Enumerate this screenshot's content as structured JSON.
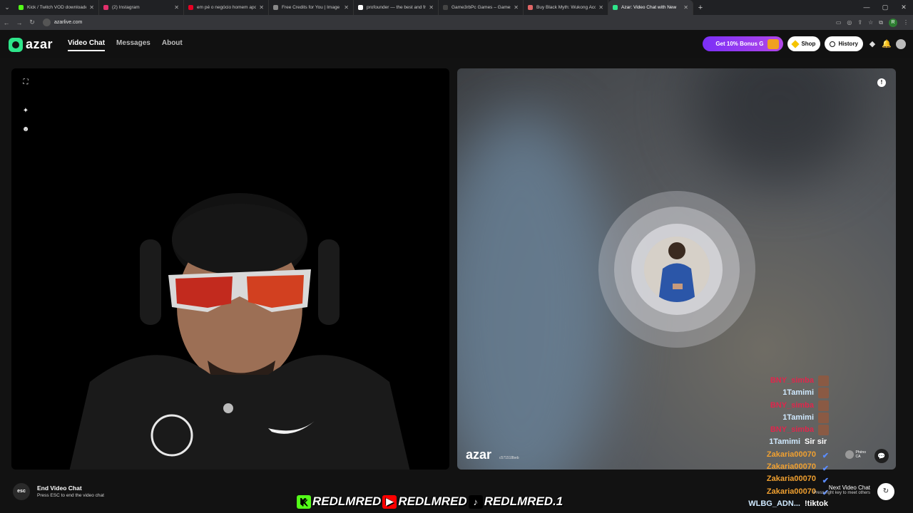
{
  "browser": {
    "tabs": [
      {
        "title": "Kick / Twitch VOD downloader",
        "color": "#53fc18"
      },
      {
        "title": "(2) Instagram",
        "color": "#e1306c"
      },
      {
        "title": "em pé o negócio homem apon",
        "color": "#e60023"
      },
      {
        "title": "Free Credits for You | Image",
        "color": "#888888"
      },
      {
        "title": "profounder — the best and fre",
        "color": "#ffffff"
      },
      {
        "title": "Game3rbPc Games – Games Or",
        "color": "#444444"
      },
      {
        "title": "Buy Black Myth: Wukong Acco",
        "color": "#e06666"
      },
      {
        "title": "Azar: Video Chat with New",
        "color": "#2ee58a",
        "active": true
      }
    ],
    "url": "azarlive.com"
  },
  "header": {
    "logo": "azar",
    "nav": [
      "Video Chat",
      "Messages",
      "About"
    ],
    "bonus": "Get 10% Bonus G",
    "shop": "Shop",
    "history": "History"
  },
  "remote": {
    "watermark": "azar",
    "watermark_id": "c571518beb"
  },
  "chat": [
    {
      "user": "BNY_simba",
      "color": "#e0264c",
      "msg": "",
      "thumb": true
    },
    {
      "user": "1Tamimi",
      "color": "#cfe9ff",
      "msg": "",
      "thumb": true
    },
    {
      "user": "BNY_simba",
      "color": "#e0264c",
      "msg": "",
      "thumb": true
    },
    {
      "user": "1Tamimi",
      "color": "#cfe9ff",
      "msg": "",
      "thumb": true
    },
    {
      "user": "BNY_simba",
      "color": "#e0264c",
      "msg": "",
      "thumb": true
    },
    {
      "user": "1Tamimi",
      "color": "#cfe9ff",
      "msg": "Sir sir",
      "thumb": false
    },
    {
      "user": "Zakaria00070",
      "color": "#f0a030",
      "msg": "",
      "thumb": false,
      "badge": true
    },
    {
      "user": "Zakaria00070",
      "color": "#f0a030",
      "msg": "",
      "thumb": false,
      "badge": true
    },
    {
      "user": "Zakaria00070",
      "color": "#f0a030",
      "msg": "",
      "thumb": false,
      "badge": true
    },
    {
      "user": "Zakaria00070",
      "color": "#f0a030",
      "msg": "",
      "thumb": false,
      "badge": true
    },
    {
      "user": "WLBG_ADN...",
      "color": "#cfe9ff",
      "msg": "!tiktok",
      "thumb": false
    }
  ],
  "mini_profile": {
    "name": "Phéno",
    "country": "CA"
  },
  "footer": {
    "esc_key": "esc",
    "end_title": "End Video Chat",
    "end_sub": "Press ESC to end the video chat",
    "next_title": "Next Video Chat",
    "next_sub": "Press right key to meet others",
    "handles": [
      "REDLMRED",
      "REDLMRED",
      "REDLMRED.1"
    ],
    "handle_icons": [
      "K",
      "▶",
      "♪"
    ]
  }
}
